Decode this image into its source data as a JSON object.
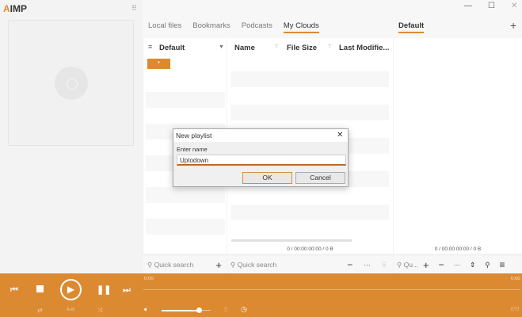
{
  "app": {
    "logo_accent": "A",
    "logo_text": "IMP"
  },
  "tabs": [
    "Local files",
    "Bookmarks",
    "Podcasts",
    "My Clouds"
  ],
  "right_tab": "Default",
  "playlist_selector": "Default",
  "columns": [
    "Name",
    "File Size",
    "Last Modifie..."
  ],
  "files_status": "0 / 00:00:00:00 / 0 B",
  "right_status": "0 / 00:00:00:00 / 0 B",
  "search": {
    "left": "Quick search",
    "middle": "Quick search",
    "right": "Qu..."
  },
  "time": {
    "elapsed": "0:00",
    "remaining": "0:00"
  },
  "ab_label": "A-B",
  "volume": 0.75,
  "dialog": {
    "title": "New playlist",
    "label": "Enter name",
    "value": "Uptodown",
    "ok": "OK",
    "cancel": "Cancel"
  },
  "colors": {
    "accent": "#dc8a32"
  }
}
